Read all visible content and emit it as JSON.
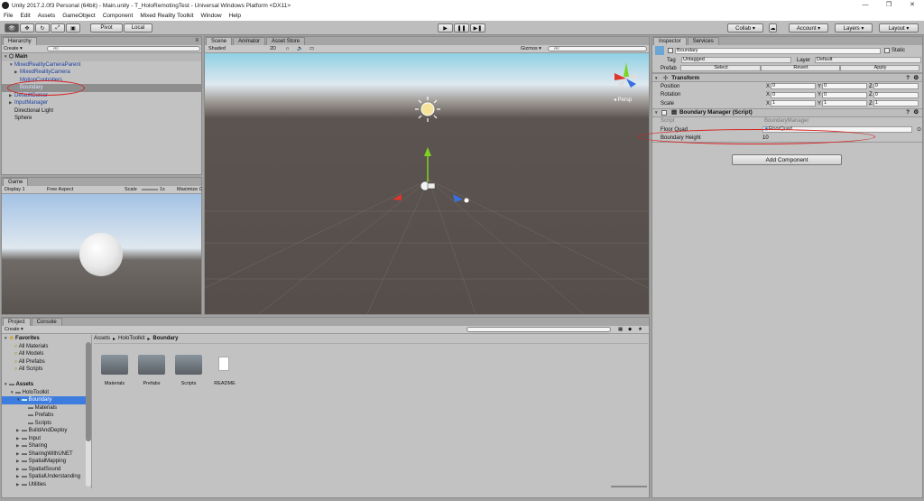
{
  "window": {
    "title": "Unity 2017.2.0f3 Personal (64bit) - Main.unity - T_HoloRemotingTest - Universal Windows Platform <DX11>"
  },
  "menu": [
    "File",
    "Edit",
    "Assets",
    "GameObject",
    "Component",
    "Mixed Reality Toolkit",
    "Window",
    "Help"
  ],
  "toolbar": {
    "pivot": "Pivot",
    "local": "Local",
    "collab": "Collab ▾",
    "account": "Account ▾",
    "layers": "Layers ▾",
    "layout": "Layout ▾"
  },
  "hierarchy": {
    "tab": "Hierarchy",
    "create": "Create ▾",
    "search": "All",
    "scene": "Main",
    "items": [
      {
        "label": "MixedRealityCameraParent",
        "depth": 1,
        "color": "#1a3fa0",
        "arrow": "▼"
      },
      {
        "label": "MixedRealityCamera",
        "depth": 2,
        "color": "#1a3fa0",
        "arrow": "▶"
      },
      {
        "label": "MotionControllers",
        "depth": 2,
        "color": "#1a3fa0",
        "arrow": ""
      },
      {
        "label": "Boundary",
        "depth": 2,
        "color": "#1a3fa0",
        "arrow": "",
        "selected": true
      },
      {
        "label": "DefaultCursor",
        "depth": 1,
        "color": "#1a3fa0",
        "arrow": "▶"
      },
      {
        "label": "InputManager",
        "depth": 1,
        "color": "#1a3fa0",
        "arrow": "▶"
      },
      {
        "label": "Directional Light",
        "depth": 1,
        "color": "#111",
        "arrow": ""
      },
      {
        "label": "Sphere",
        "depth": 1,
        "color": "#111",
        "arrow": ""
      }
    ]
  },
  "scene": {
    "tabs": [
      "Scene",
      "Animator",
      "Asset Store"
    ],
    "shaded": "Shaded",
    "mode2d": "2D",
    "gizmos": "Gizmos ▾",
    "search": "All",
    "persp": "◂ Persp"
  },
  "game": {
    "tab": "Game",
    "display": "Display 1",
    "aspect": "Free Aspect",
    "scale": "Scale",
    "scale_val": "1x",
    "maximize": "Maximize On Play"
  },
  "inspector": {
    "tabs": [
      "Inspector",
      "Services"
    ],
    "name": "Boundary",
    "static": "Static",
    "tag_label": "Tag",
    "tag": "Untagged",
    "layer_label": "Layer",
    "layer": "Default",
    "prefab_label": "Prefab",
    "prefab_buttons": [
      "Select",
      "Revert",
      "Apply"
    ],
    "transform": "Transform",
    "transform_rows": [
      {
        "label": "Position",
        "x": "0",
        "y": "0",
        "z": "0"
      },
      {
        "label": "Rotation",
        "x": "0",
        "y": "0",
        "z": "0"
      },
      {
        "label": "Scale",
        "x": "1",
        "y": "1",
        "z": "1"
      }
    ],
    "component": "Boundary Manager (Script)",
    "script_label": "Script",
    "script_val": "BoundaryManager",
    "floor_label": "Floor Quad",
    "floor_val": "FloorQuad",
    "height_label": "Boundary Height",
    "height_val": "10",
    "add_component": "Add Component"
  },
  "project": {
    "tabs": [
      "Project",
      "Console"
    ],
    "create": "Create ▾",
    "favorites": "Favorites",
    "fav_items": [
      "All Materials",
      "All Models",
      "All Prefabs",
      "All Scripts"
    ],
    "assets": "Assets",
    "tree": [
      {
        "label": "HoloToolkit",
        "depth": 1,
        "arrow": "▼"
      },
      {
        "label": "Boundary",
        "depth": 2,
        "arrow": "▼",
        "selected": true
      },
      {
        "label": "Materials",
        "depth": 3,
        "arrow": ""
      },
      {
        "label": "Prefabs",
        "depth": 3,
        "arrow": ""
      },
      {
        "label": "Scripts",
        "depth": 3,
        "arrow": ""
      },
      {
        "label": "BuildAndDeploy",
        "depth": 2,
        "arrow": "▶"
      },
      {
        "label": "Input",
        "depth": 2,
        "arrow": "▶"
      },
      {
        "label": "Sharing",
        "depth": 2,
        "arrow": "▶"
      },
      {
        "label": "SharingWithUNET",
        "depth": 2,
        "arrow": "▶"
      },
      {
        "label": "SpatialMapping",
        "depth": 2,
        "arrow": "▶"
      },
      {
        "label": "SpatialSound",
        "depth": 2,
        "arrow": "▶"
      },
      {
        "label": "SpatialUnderstanding",
        "depth": 2,
        "arrow": "▶"
      },
      {
        "label": "Utilities",
        "depth": 2,
        "arrow": "▶"
      }
    ],
    "breadcrumb": [
      "Assets",
      "HoloToolkit",
      "Boundary"
    ],
    "files": [
      "Materials",
      "Prefabs",
      "Scripts",
      "README"
    ]
  }
}
